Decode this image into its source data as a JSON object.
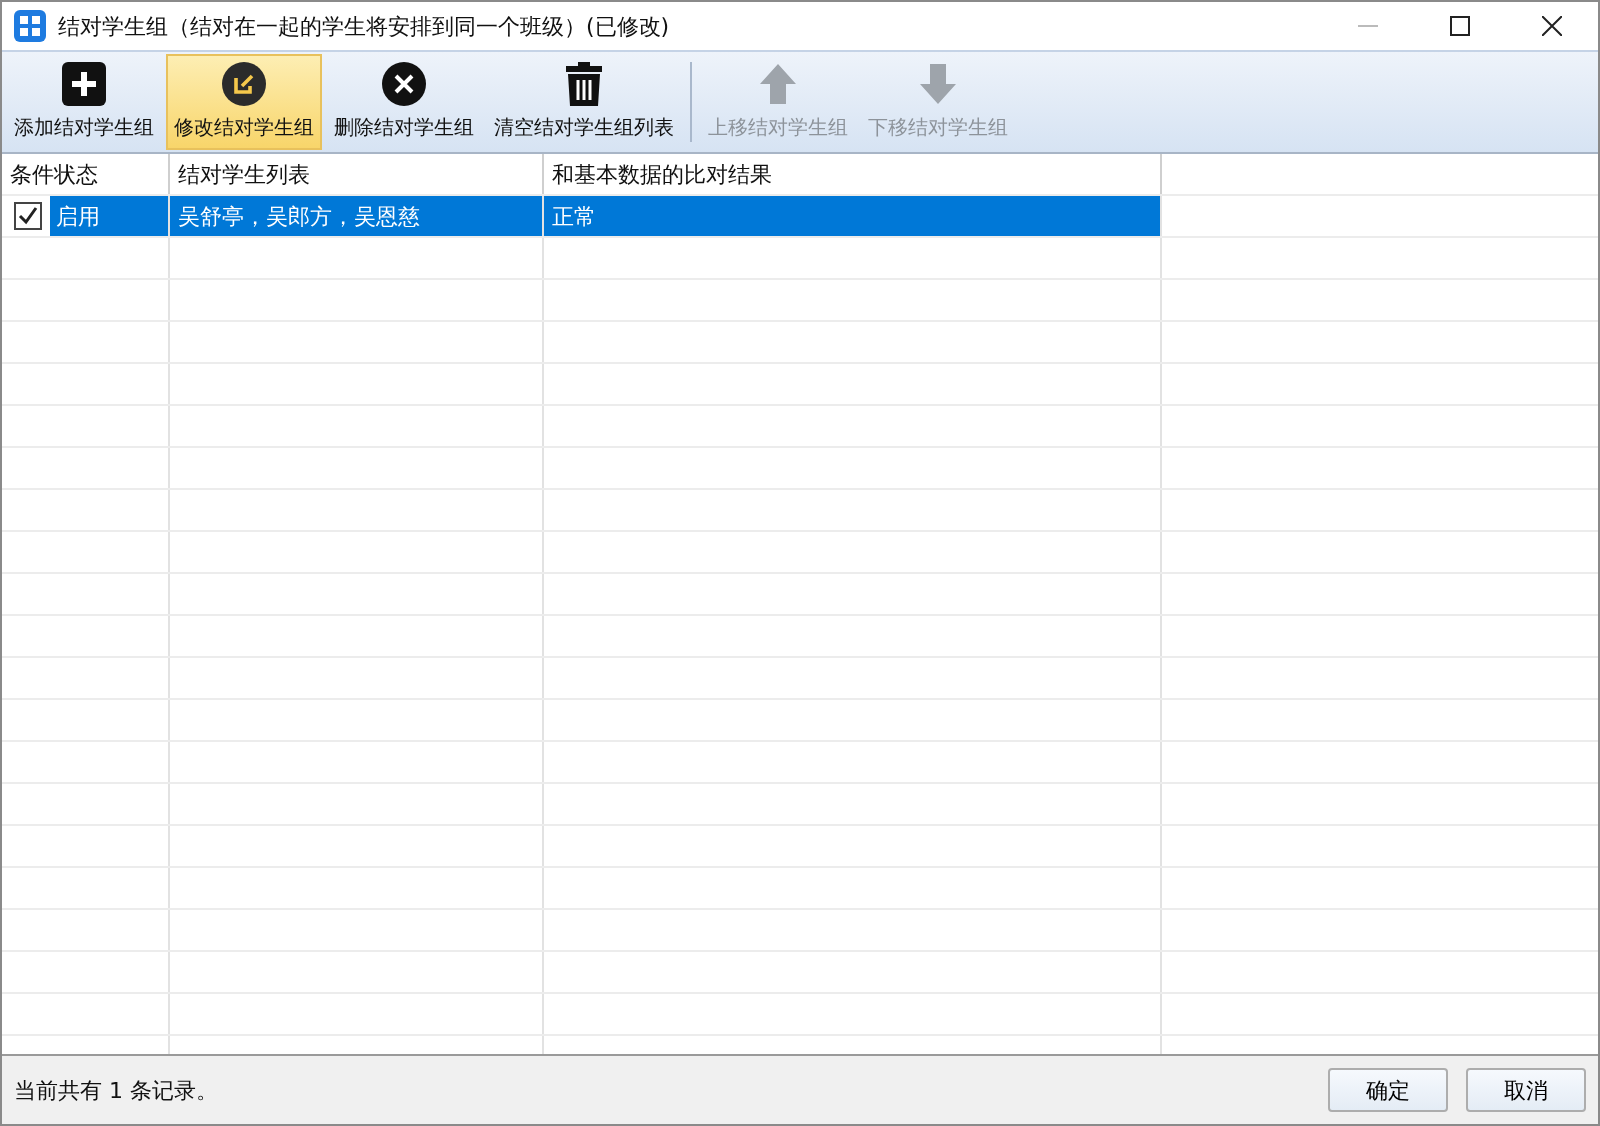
{
  "window": {
    "title": "结对学生组（结对在一起的学生将安排到同一个班级）(已修改)"
  },
  "toolbar": [
    {
      "label": "添加结对学生组",
      "kind": "add",
      "selected": false,
      "disabled": false
    },
    {
      "label": "修改结对学生组",
      "kind": "edit",
      "selected": true,
      "disabled": false
    },
    {
      "label": "删除结对学生组",
      "kind": "delete",
      "selected": false,
      "disabled": false
    },
    {
      "label": "清空结对学生组列表",
      "kind": "clear",
      "selected": false,
      "disabled": false
    },
    {
      "label": "上移结对学生组",
      "kind": "up",
      "selected": false,
      "disabled": true
    },
    {
      "label": "下移结对学生组",
      "kind": "down",
      "selected": false,
      "disabled": true
    }
  ],
  "table": {
    "columns": [
      "条件状态",
      "结对学生列表",
      "和基本数据的比对结果"
    ],
    "rows": [
      {
        "checked": true,
        "selected": true,
        "status": "启用",
        "students": "吴舒亭，吴郎方，吴恩慈",
        "result": "正常"
      }
    ]
  },
  "status_bar": {
    "text": "当前共有 1 条记录。"
  },
  "buttons": [
    "确定",
    "取消"
  ]
}
